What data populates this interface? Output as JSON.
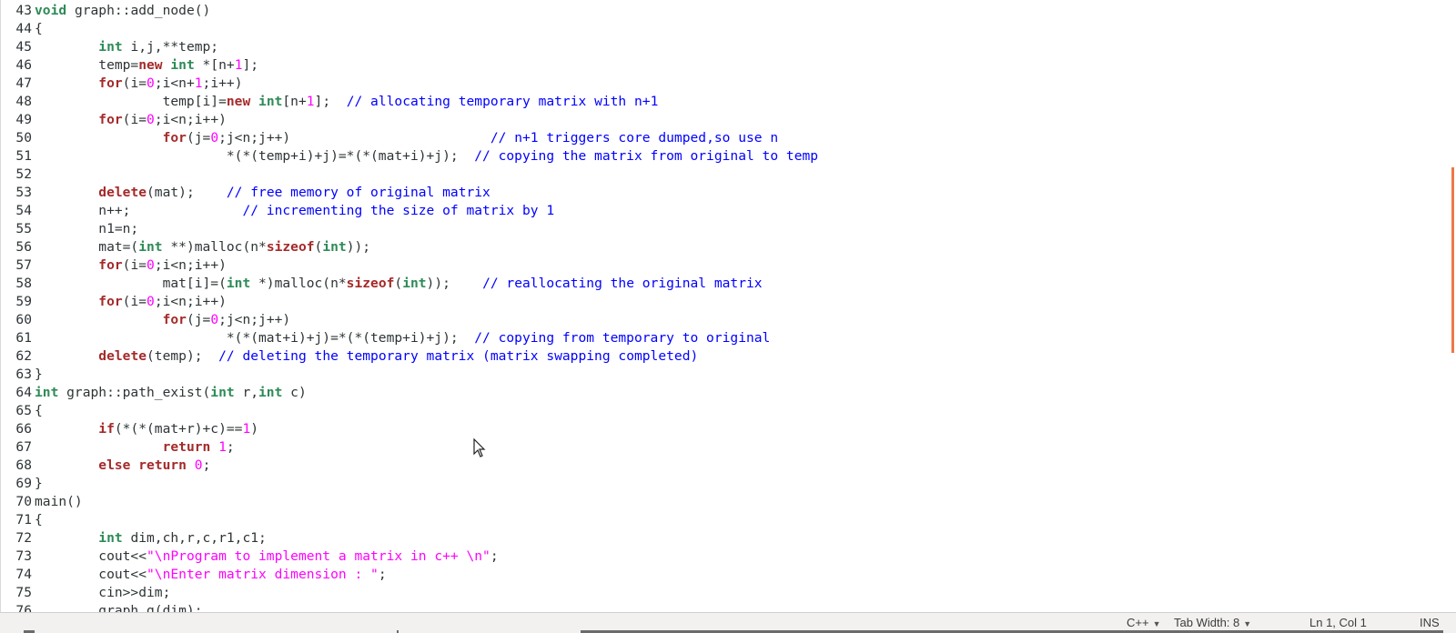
{
  "editor": {
    "lines": [
      {
        "n": "43",
        "tokens": [
          [
            "ty",
            "void"
          ],
          [
            "t",
            " graph::add_node()"
          ]
        ]
      },
      {
        "n": "44",
        "tokens": [
          [
            "t",
            "{"
          ]
        ]
      },
      {
        "n": "45",
        "tokens": [
          [
            "t",
            "        "
          ],
          [
            "ty",
            "int"
          ],
          [
            "t",
            " i,j,**temp;"
          ]
        ]
      },
      {
        "n": "46",
        "tokens": [
          [
            "t",
            "        temp="
          ],
          [
            "kw",
            "new"
          ],
          [
            "t",
            " "
          ],
          [
            "ty",
            "int"
          ],
          [
            "t",
            " *[n+"
          ],
          [
            "num",
            "1"
          ],
          [
            "t",
            "];"
          ]
        ]
      },
      {
        "n": "47",
        "tokens": [
          [
            "t",
            "        "
          ],
          [
            "kw",
            "for"
          ],
          [
            "t",
            "(i="
          ],
          [
            "num",
            "0"
          ],
          [
            "t",
            ";i<n+"
          ],
          [
            "num",
            "1"
          ],
          [
            "t",
            ";i++)"
          ]
        ]
      },
      {
        "n": "48",
        "tokens": [
          [
            "t",
            "                temp[i]="
          ],
          [
            "kw",
            "new"
          ],
          [
            "t",
            " "
          ],
          [
            "ty",
            "int"
          ],
          [
            "t",
            "[n+"
          ],
          [
            "num",
            "1"
          ],
          [
            "t",
            "];  "
          ],
          [
            "cm",
            "// allocating temporary matrix with n+1"
          ]
        ]
      },
      {
        "n": "49",
        "tokens": [
          [
            "t",
            "        "
          ],
          [
            "kw",
            "for"
          ],
          [
            "t",
            "(i="
          ],
          [
            "num",
            "0"
          ],
          [
            "t",
            ";i<n;i++)"
          ]
        ]
      },
      {
        "n": "50",
        "tokens": [
          [
            "t",
            "                "
          ],
          [
            "kw",
            "for"
          ],
          [
            "t",
            "(j="
          ],
          [
            "num",
            "0"
          ],
          [
            "t",
            ";j<n;j++)                         "
          ],
          [
            "cm",
            "// n+1 triggers core dumped,so use n"
          ]
        ]
      },
      {
        "n": "51",
        "tokens": [
          [
            "t",
            "                        *(*(temp+i)+j)=*(*(mat+i)+j);  "
          ],
          [
            "cm",
            "// copying the matrix from original to temp"
          ]
        ]
      },
      {
        "n": "52",
        "tokens": []
      },
      {
        "n": "53",
        "tokens": [
          [
            "t",
            "        "
          ],
          [
            "kw",
            "delete"
          ],
          [
            "t",
            "(mat);    "
          ],
          [
            "cm",
            "// free memory of original matrix"
          ]
        ]
      },
      {
        "n": "54",
        "tokens": [
          [
            "t",
            "        n++;              "
          ],
          [
            "cm",
            "// incrementing the size of matrix by 1"
          ]
        ]
      },
      {
        "n": "55",
        "tokens": [
          [
            "t",
            "        n1=n;"
          ]
        ]
      },
      {
        "n": "56",
        "tokens": [
          [
            "t",
            "        mat=("
          ],
          [
            "ty",
            "int"
          ],
          [
            "t",
            " **)malloc(n*"
          ],
          [
            "kw",
            "sizeof"
          ],
          [
            "t",
            "("
          ],
          [
            "ty",
            "int"
          ],
          [
            "t",
            "));"
          ]
        ]
      },
      {
        "n": "57",
        "tokens": [
          [
            "t",
            "        "
          ],
          [
            "kw",
            "for"
          ],
          [
            "t",
            "(i="
          ],
          [
            "num",
            "0"
          ],
          [
            "t",
            ";i<n;i++)"
          ]
        ]
      },
      {
        "n": "58",
        "tokens": [
          [
            "t",
            "                mat[i]=("
          ],
          [
            "ty",
            "int"
          ],
          [
            "t",
            " *)malloc(n*"
          ],
          [
            "kw",
            "sizeof"
          ],
          [
            "t",
            "("
          ],
          [
            "ty",
            "int"
          ],
          [
            "t",
            "));    "
          ],
          [
            "cm",
            "// reallocating the original matrix"
          ]
        ]
      },
      {
        "n": "59",
        "tokens": [
          [
            "t",
            "        "
          ],
          [
            "kw",
            "for"
          ],
          [
            "t",
            "(i="
          ],
          [
            "num",
            "0"
          ],
          [
            "t",
            ";i<n;i++)"
          ]
        ]
      },
      {
        "n": "60",
        "tokens": [
          [
            "t",
            "                "
          ],
          [
            "kw",
            "for"
          ],
          [
            "t",
            "(j="
          ],
          [
            "num",
            "0"
          ],
          [
            "t",
            ";j<n;j++)"
          ]
        ]
      },
      {
        "n": "61",
        "tokens": [
          [
            "t",
            "                        *(*(mat+i)+j)=*(*(temp+i)+j);  "
          ],
          [
            "cm",
            "// copying from temporary to original"
          ]
        ]
      },
      {
        "n": "62",
        "tokens": [
          [
            "t",
            "        "
          ],
          [
            "kw",
            "delete"
          ],
          [
            "t",
            "(temp);  "
          ],
          [
            "cm",
            "// deleting the temporary matrix (matrix swapping completed)"
          ]
        ]
      },
      {
        "n": "63",
        "tokens": [
          [
            "t",
            "}"
          ]
        ]
      },
      {
        "n": "64",
        "tokens": [
          [
            "ty",
            "int"
          ],
          [
            "t",
            " graph::path_exist("
          ],
          [
            "ty",
            "int"
          ],
          [
            "t",
            " r,"
          ],
          [
            "ty",
            "int"
          ],
          [
            "t",
            " c)"
          ]
        ]
      },
      {
        "n": "65",
        "tokens": [
          [
            "t",
            "{"
          ]
        ]
      },
      {
        "n": "66",
        "tokens": [
          [
            "t",
            "        "
          ],
          [
            "kw",
            "if"
          ],
          [
            "t",
            "(*(*(mat+r)+c)=="
          ],
          [
            "num",
            "1"
          ],
          [
            "t",
            ")"
          ]
        ]
      },
      {
        "n": "67",
        "tokens": [
          [
            "t",
            "                "
          ],
          [
            "kw",
            "return"
          ],
          [
            "t",
            " "
          ],
          [
            "num",
            "1"
          ],
          [
            "t",
            ";"
          ]
        ]
      },
      {
        "n": "68",
        "tokens": [
          [
            "t",
            "        "
          ],
          [
            "kw",
            "else"
          ],
          [
            "t",
            " "
          ],
          [
            "kw",
            "return"
          ],
          [
            "t",
            " "
          ],
          [
            "num",
            "0"
          ],
          [
            "t",
            ";"
          ]
        ]
      },
      {
        "n": "69",
        "tokens": [
          [
            "t",
            "}"
          ]
        ]
      },
      {
        "n": "70",
        "tokens": [
          [
            "t",
            "main()"
          ]
        ]
      },
      {
        "n": "71",
        "tokens": [
          [
            "t",
            "{"
          ]
        ]
      },
      {
        "n": "72",
        "tokens": [
          [
            "t",
            "        "
          ],
          [
            "ty",
            "int"
          ],
          [
            "t",
            " dim,ch,r,c,r1,c1;"
          ]
        ]
      },
      {
        "n": "73",
        "tokens": [
          [
            "t",
            "        cout<<"
          ],
          [
            "str",
            "\"\\nProgram to implement a matrix in c++ \\n\""
          ],
          [
            "t",
            ";"
          ]
        ]
      },
      {
        "n": "74",
        "tokens": [
          [
            "t",
            "        cout<<"
          ],
          [
            "str",
            "\"\\nEnter matrix dimension : \""
          ],
          [
            "t",
            ";"
          ]
        ]
      },
      {
        "n": "75",
        "tokens": [
          [
            "t",
            "        cin>>dim;"
          ]
        ]
      },
      {
        "n": "76",
        "tokens": [
          [
            "t",
            "        graph g(dim);"
          ]
        ]
      }
    ]
  },
  "statusbar": {
    "language": "C++",
    "tab_width": "Tab Width: 8",
    "position": "Ln 1, Col 1",
    "mode": "INS"
  },
  "colors": {
    "keyword": "#a52a2a",
    "type": "#2e8b57",
    "number": "#ff00ff",
    "string": "#ff00ff",
    "comment": "#0000ff",
    "scroll_indicator": "#f07746"
  },
  "icons": {
    "dropdown": "chevron-down-icon",
    "pointer": "mouse-pointer-icon"
  }
}
